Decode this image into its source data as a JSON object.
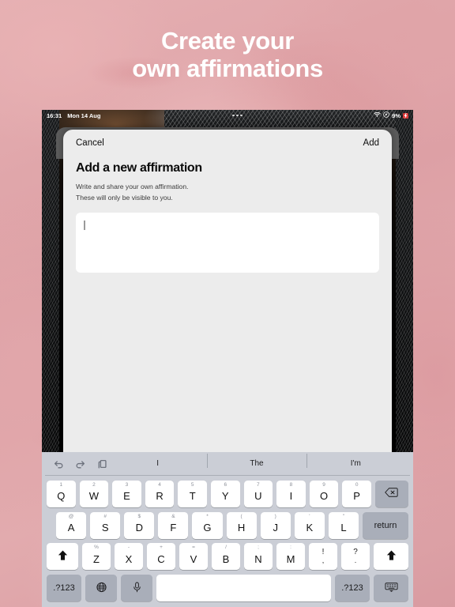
{
  "promo": {
    "headline_line1": "Create your",
    "headline_line2": "own affirmations",
    "text_color": "#ffffff",
    "background_color": "#e0a5aa"
  },
  "device": {
    "statusbar": {
      "time": "16:31",
      "date": "Mon 14 Aug",
      "wifi_icon": "wifi-icon",
      "location_icon": "location-icon",
      "battery_percent": "9%",
      "battery_charging_icon": "battery-charging-icon",
      "multitask_handle": "multitask-dots"
    }
  },
  "sheet": {
    "cancel_label": "Cancel",
    "add_label": "Add",
    "title": "Add a new affirmation",
    "subtitle_line1": "Write and share your own affirmation.",
    "subtitle_line2": "These will only be visible to you.",
    "input_value": "",
    "input_placeholder": "",
    "background_color": "#ececec",
    "input_background": "#ffffff"
  },
  "keyboard": {
    "background_color": "#cbced6",
    "key_color": "#ffffff",
    "modifier_key_color": "#a9aeb9",
    "toolbar": {
      "undo_icon": "undo-icon",
      "redo_icon": "redo-icon",
      "paste_icon": "paste-icon",
      "predictions": [
        "I",
        "The",
        "I'm"
      ]
    },
    "row1": [
      {
        "main": "Q",
        "alt": "1"
      },
      {
        "main": "W",
        "alt": "2"
      },
      {
        "main": "E",
        "alt": "3"
      },
      {
        "main": "R",
        "alt": "4"
      },
      {
        "main": "T",
        "alt": "5"
      },
      {
        "main": "Y",
        "alt": "6"
      },
      {
        "main": "U",
        "alt": "7"
      },
      {
        "main": "I",
        "alt": "8"
      },
      {
        "main": "O",
        "alt": "9"
      },
      {
        "main": "P",
        "alt": "0"
      }
    ],
    "backspace_icon": "backspace-icon",
    "row2": [
      {
        "main": "A",
        "alt": "@"
      },
      {
        "main": "S",
        "alt": "#"
      },
      {
        "main": "D",
        "alt": "$"
      },
      {
        "main": "F",
        "alt": "&"
      },
      {
        "main": "G",
        "alt": "*"
      },
      {
        "main": "H",
        "alt": "("
      },
      {
        "main": "J",
        "alt": ")"
      },
      {
        "main": "K",
        "alt": "'"
      },
      {
        "main": "L",
        "alt": "\""
      }
    ],
    "return_label": "return",
    "row3": [
      {
        "main": "Z",
        "alt": "%"
      },
      {
        "main": "X",
        "alt": "-"
      },
      {
        "main": "C",
        "alt": "+"
      },
      {
        "main": "V",
        "alt": "="
      },
      {
        "main": "B",
        "alt": "/"
      },
      {
        "main": "N",
        "alt": ";"
      },
      {
        "main": "M",
        "alt": ":"
      }
    ],
    "punct_keys": [
      {
        "up": "!",
        "dn": ","
      },
      {
        "up": "?",
        "dn": "."
      }
    ],
    "shift_left_icon": "shift-icon",
    "shift_right_icon": "shift-icon",
    "row4": {
      "numeric_left_label": ".?123",
      "globe_icon": "globe-icon",
      "mic_icon": "microphone-icon",
      "space_label": "",
      "numeric_right_label": ".?123",
      "dismiss_icon": "keyboard-dismiss-icon"
    }
  }
}
